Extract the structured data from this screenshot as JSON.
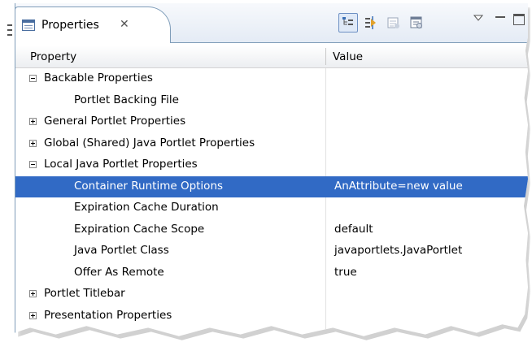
{
  "view": {
    "tab_label": "Properties",
    "close_icon": "✕"
  },
  "toolbar": {
    "buttons": [
      {
        "icon": "show-categories-icon",
        "active": true
      },
      {
        "icon": "show-advanced-icon",
        "active": false
      },
      {
        "icon": "restore-default-icon",
        "active": false
      },
      {
        "icon": "filter-icon",
        "active": false
      }
    ],
    "menu_icon": "view-menu-icon",
    "minimize_icon": "minimize-icon",
    "maximize_icon": "maximize-icon"
  },
  "table": {
    "col_property": "Property",
    "col_value": "Value",
    "rows": [
      {
        "name": "Backable Properties",
        "value": "",
        "level": 0,
        "expander": "minus",
        "selected": false
      },
      {
        "name": "Portlet Backing File",
        "value": "",
        "level": 1,
        "expander": "",
        "selected": false
      },
      {
        "name": "General Portlet Properties",
        "value": "",
        "level": 0,
        "expander": "plus",
        "selected": false
      },
      {
        "name": "Global (Shared) Java Portlet Properties",
        "value": "",
        "level": 0,
        "expander": "plus",
        "selected": false
      },
      {
        "name": "Local Java Portlet Properties",
        "value": "",
        "level": 0,
        "expander": "minus",
        "selected": false
      },
      {
        "name": "Container Runtime Options",
        "value": "AnAttribute=new value",
        "level": 1,
        "expander": "",
        "selected": true
      },
      {
        "name": "Expiration Cache Duration",
        "value": "",
        "level": 1,
        "expander": "",
        "selected": false
      },
      {
        "name": "Expiration Cache Scope",
        "value": "default",
        "level": 1,
        "expander": "",
        "selected": false
      },
      {
        "name": "Java Portlet Class",
        "value": "javaportlets.JavaPortlet",
        "level": 1,
        "expander": "",
        "selected": false
      },
      {
        "name": "Offer As Remote",
        "value": "true",
        "level": 1,
        "expander": "",
        "selected": false
      },
      {
        "name": "Portlet Titlebar",
        "value": "",
        "level": 0,
        "expander": "plus",
        "selected": false
      },
      {
        "name": "Presentation Properties",
        "value": "",
        "level": 0,
        "expander": "plus",
        "selected": false
      }
    ]
  },
  "colors": {
    "selection": "#316ac5",
    "border": "#7f9db9"
  }
}
